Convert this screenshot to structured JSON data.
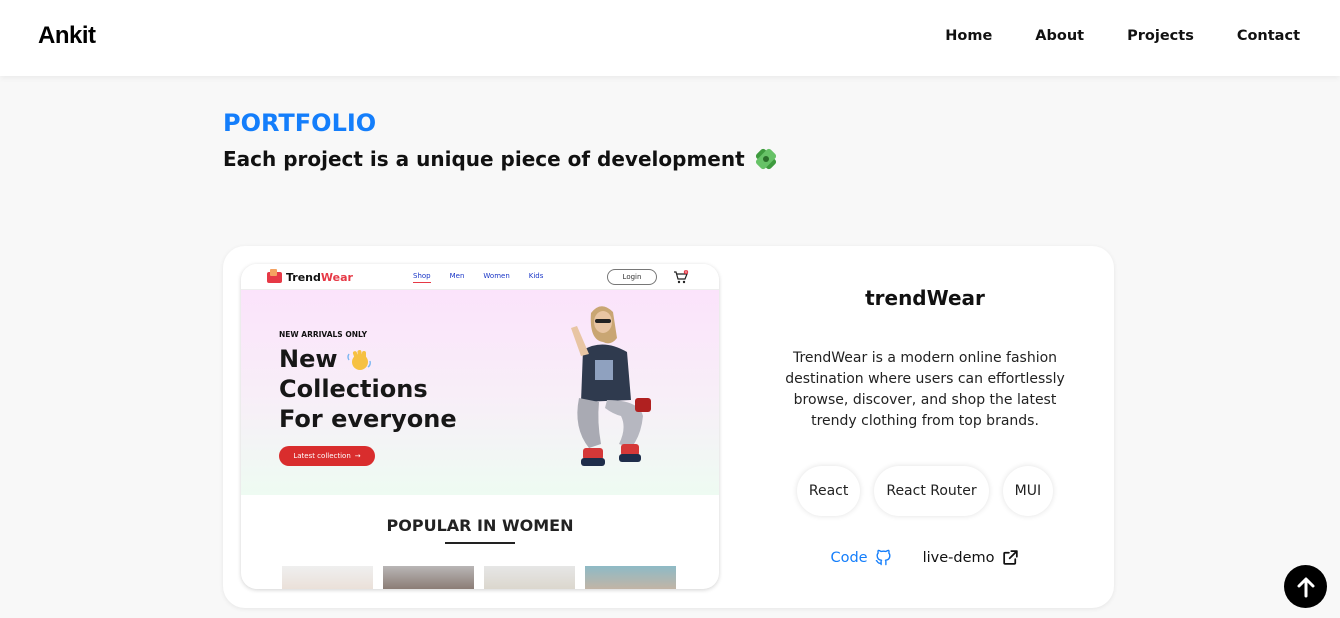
{
  "header": {
    "logo": "Ankit",
    "nav": [
      "Home",
      "About",
      "Projects",
      "Contact"
    ]
  },
  "portfolio": {
    "label": "PORTFOLIO",
    "title": "Each project is a unique piece of development"
  },
  "project": {
    "title": "trendWear",
    "description": "TrendWear is a modern online fashion destination where users can effortlessly browse, discover, and shop the latest trendy clothing from top brands.",
    "tags": [
      "React",
      "React Router",
      "MUI"
    ],
    "links": {
      "code": "Code",
      "demo": "live-demo"
    },
    "preview": {
      "logo_prefix": "Trend",
      "logo_suffix": "Wear",
      "nav": [
        "Shop",
        "Men",
        "Women",
        "Kids"
      ],
      "login": "Login",
      "cart_count": "0",
      "tagline": "NEW ARRIVALS ONLY",
      "headline_line1": "New",
      "headline_line2": "Collections",
      "headline_line3": "For everyone",
      "button": "Latest collection",
      "section_title": "POPULAR IN WOMEN"
    }
  },
  "colors": {
    "accent": "#147efb",
    "preview_red": "#d92d2d",
    "background": "#f8f8f8"
  },
  "icons": [
    "puzzle-icon",
    "github-icon",
    "external-link-icon",
    "arrow-up-icon",
    "cart-icon",
    "wave-hand-icon"
  ]
}
